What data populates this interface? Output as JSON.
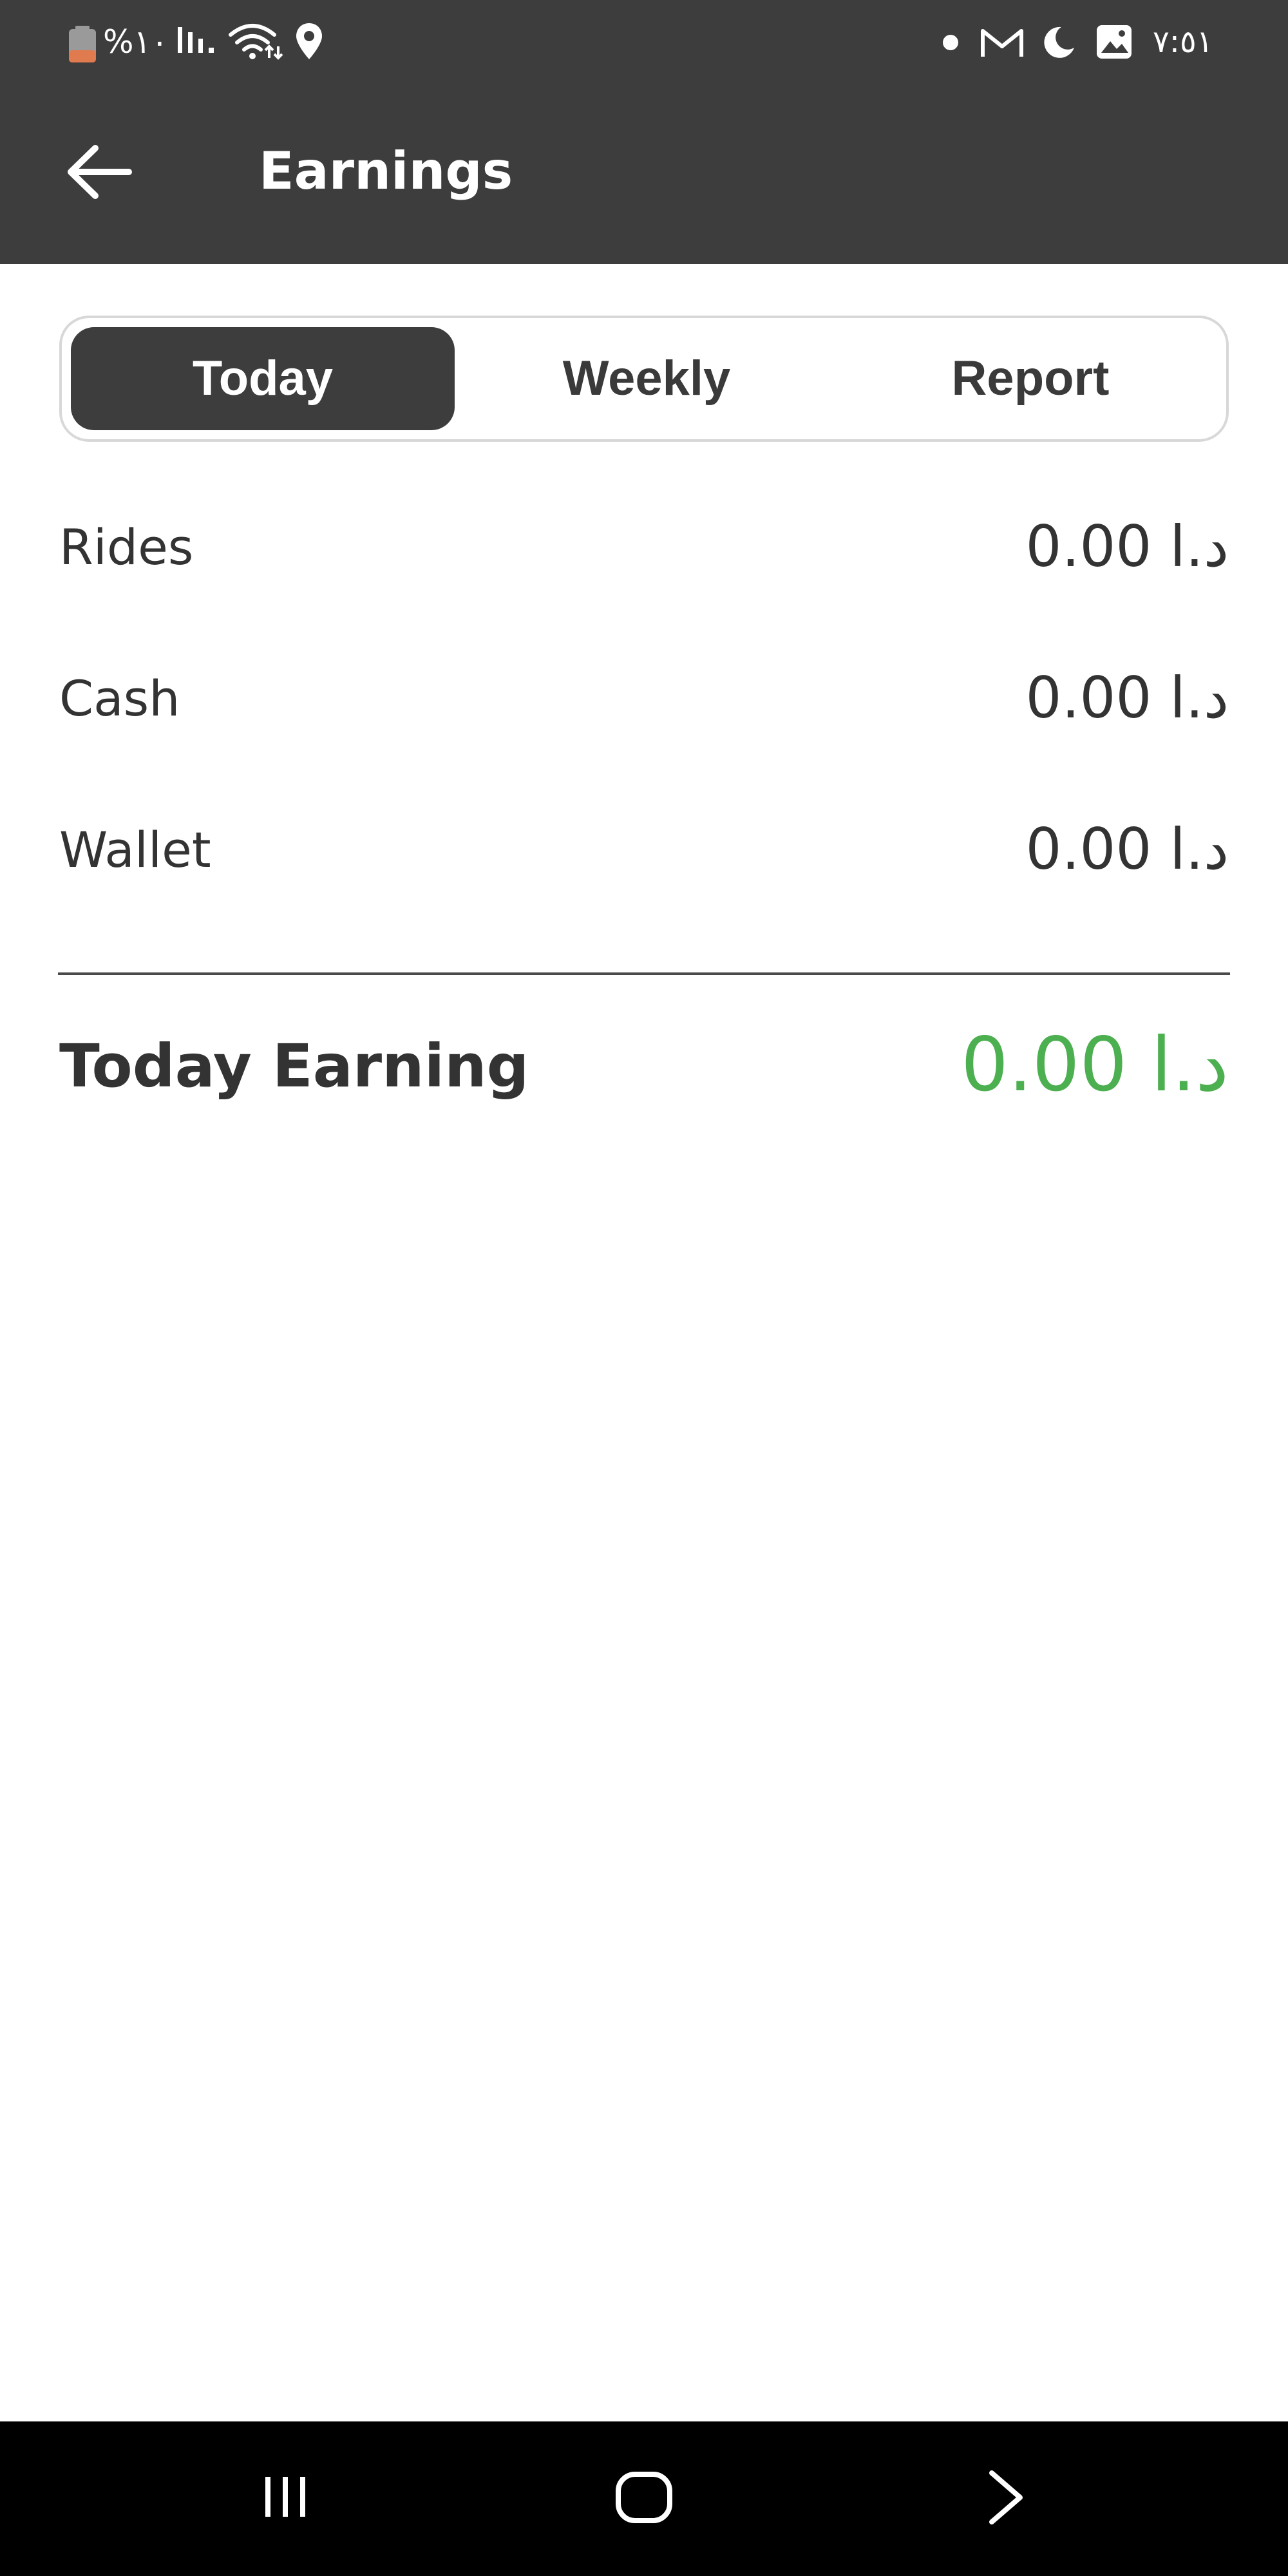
{
  "status_bar": {
    "battery_text": "%١٠",
    "time": "٧:٥١",
    "icons": [
      "battery-icon",
      "signal-icon",
      "wifi-icon",
      "location-icon",
      "notification-dot-icon",
      "gmail-icon",
      "do-not-disturb-moon-icon",
      "gallery-icon"
    ]
  },
  "app_bar": {
    "title": "Earnings",
    "back_icon": "arrow-left-icon"
  },
  "tabs": {
    "items": [
      {
        "label": "Today",
        "selected": true
      },
      {
        "label": "Weekly",
        "selected": false
      },
      {
        "label": "Report",
        "selected": false
      }
    ]
  },
  "earnings": {
    "rows": [
      {
        "label": "Rides",
        "value": "0.00 د.ا"
      },
      {
        "label": "Cash",
        "value": "0.00 د.ا"
      },
      {
        "label": "Wallet",
        "value": "0.00 د.ا"
      }
    ],
    "total": {
      "label": "Today Earning",
      "value": "0.00 د.ا"
    }
  },
  "colors": {
    "header_bg": "#3d3d3d",
    "selected_tab_bg": "#3d3d3d",
    "total_value": "#4caf50",
    "text": "#333333",
    "nav_bar_bg": "#000000"
  },
  "nav_bar": {
    "icons": [
      "recents-icon",
      "home-icon",
      "back-chevron-icon"
    ]
  }
}
